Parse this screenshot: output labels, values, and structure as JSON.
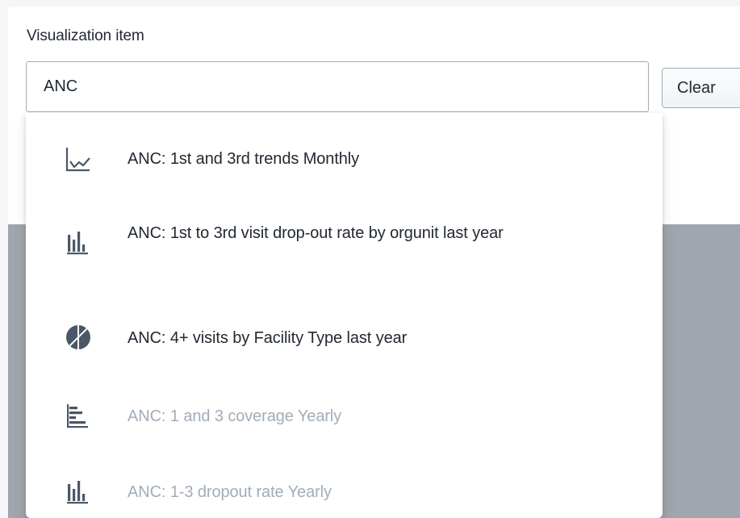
{
  "field": {
    "label": "Visualization item",
    "value": "ANC",
    "clear_label": "Clear"
  },
  "menu": {
    "items": [
      {
        "label": "ANC: 1st and 3rd trends Monthly",
        "icon": "line-chart-icon",
        "enabled": true
      },
      {
        "label": "ANC: 1st to 3rd visit drop-out rate by orgunit last year",
        "icon": "column-chart-icon",
        "enabled": true
      },
      {
        "label": "ANC: 4+ visits by Facility Type last year",
        "icon": "pie-chart-icon",
        "enabled": true
      },
      {
        "label": "ANC: 1 and 3 coverage Yearly",
        "icon": "bar-chart-icon",
        "enabled": false
      },
      {
        "label": "ANC: 1-3 dropout rate Yearly",
        "icon": "column-chart-icon",
        "enabled": false
      }
    ]
  },
  "colors": {
    "text": "#212934",
    "disabled_text": "#a0adba",
    "icon": "#4a5768",
    "backdrop": "#a0a6ad"
  }
}
